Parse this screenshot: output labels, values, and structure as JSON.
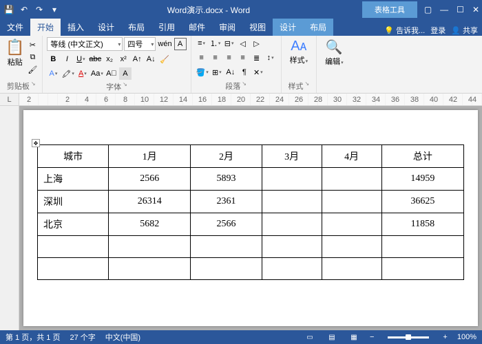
{
  "titlebar": {
    "title": "Word演示.docx - Word",
    "context_tab": "表格工具"
  },
  "tabs": {
    "list": [
      {
        "label": "文件"
      },
      {
        "label": "开始"
      },
      {
        "label": "插入"
      },
      {
        "label": "设计"
      },
      {
        "label": "布局"
      },
      {
        "label": "引用"
      },
      {
        "label": "邮件"
      },
      {
        "label": "审阅"
      },
      {
        "label": "视图"
      },
      {
        "label": "设计"
      },
      {
        "label": "布局"
      }
    ],
    "active": 1,
    "tell_me": "告诉我...",
    "signin": "登录",
    "share": "共享"
  },
  "ribbon": {
    "clipboard": {
      "paste": "粘贴",
      "label": "剪贴板"
    },
    "font": {
      "name": "等线 (中文正文)",
      "size": "四号",
      "label": "字体"
    },
    "para": {
      "label": "段落"
    },
    "styles": {
      "btn": "样式",
      "label": "样式"
    },
    "edit": {
      "btn": "编辑"
    }
  },
  "ruler": {
    "corner": "L",
    "marks": [
      "2",
      "",
      "2",
      "4",
      "6",
      "8",
      "10",
      "12",
      "14",
      "16",
      "18",
      "20",
      "22",
      "24",
      "26",
      "28",
      "30",
      "32",
      "34",
      "36",
      "38",
      "40",
      "42",
      "44"
    ]
  },
  "table": {
    "header": [
      "城市",
      "1月",
      "2月",
      "3月",
      "4月",
      "总计"
    ],
    "rows": [
      [
        "上海",
        "2566",
        "5893",
        "",
        "",
        "14959"
      ],
      [
        "深圳",
        "26314",
        "2361",
        "",
        "",
        "36625"
      ],
      [
        "北京",
        "5682",
        "2566",
        "",
        "",
        "11858"
      ],
      [
        "",
        "",
        "",
        "",
        "",
        ""
      ],
      [
        "",
        "",
        "",
        "",
        "",
        ""
      ]
    ]
  },
  "status": {
    "page": "第 1 页，共 1 页",
    "words": "27 个字",
    "lang": "中文(中国)",
    "zoom": "100%"
  }
}
